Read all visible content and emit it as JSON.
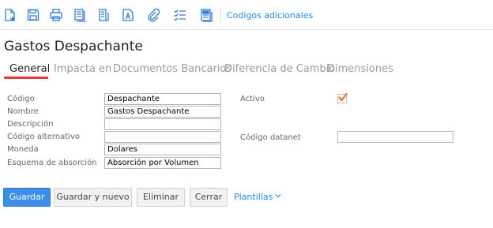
{
  "toolbar": {
    "icons": [
      "new-doc-icon",
      "save-icon",
      "print-icon",
      "copy-docs-icon",
      "document-list-icon",
      "text-doc-icon",
      "paperclip-icon",
      "checklist-icon",
      "calculator-doc-icon"
    ],
    "link_label": "Codigos adicionales"
  },
  "page": {
    "title": "Gastos Despachante"
  },
  "tabs": [
    {
      "label": "General",
      "active": true
    },
    {
      "label": "Impacta en",
      "active": false
    },
    {
      "label": "Documentos Bancarios",
      "active": false
    },
    {
      "label": "Diferencia de Cambio",
      "active": false
    },
    {
      "label": "Dimensiones",
      "active": false
    }
  ],
  "form": {
    "codigo": {
      "label": "Código",
      "value": "Despachante"
    },
    "nombre": {
      "label": "Nombre",
      "value": "Gastos Despachante"
    },
    "descripcion": {
      "label": "Descripción",
      "value": ""
    },
    "codigo_alternativo": {
      "label": "Código alternativo",
      "value": ""
    },
    "moneda": {
      "label": "Moneda",
      "value": "Dolares"
    },
    "esquema": {
      "label": "Esquema de absorción",
      "value": "Absorción por Volumen"
    },
    "activo": {
      "label": "Activo",
      "checked": true
    },
    "codigo_datanet": {
      "label": "Código datanet",
      "value": ""
    }
  },
  "actions": {
    "guardar": "Guardar",
    "guardar_nuevo": "Guardar y nuevo",
    "eliminar": "Eliminar",
    "cerrar": "Cerrar",
    "plantillas": "Plantillas"
  },
  "colors": {
    "accent": "#1e88e5",
    "primary_button": "#3d8ee6",
    "active_tab_underline": "#e53935",
    "checkbox_mark": "#e8702a"
  }
}
